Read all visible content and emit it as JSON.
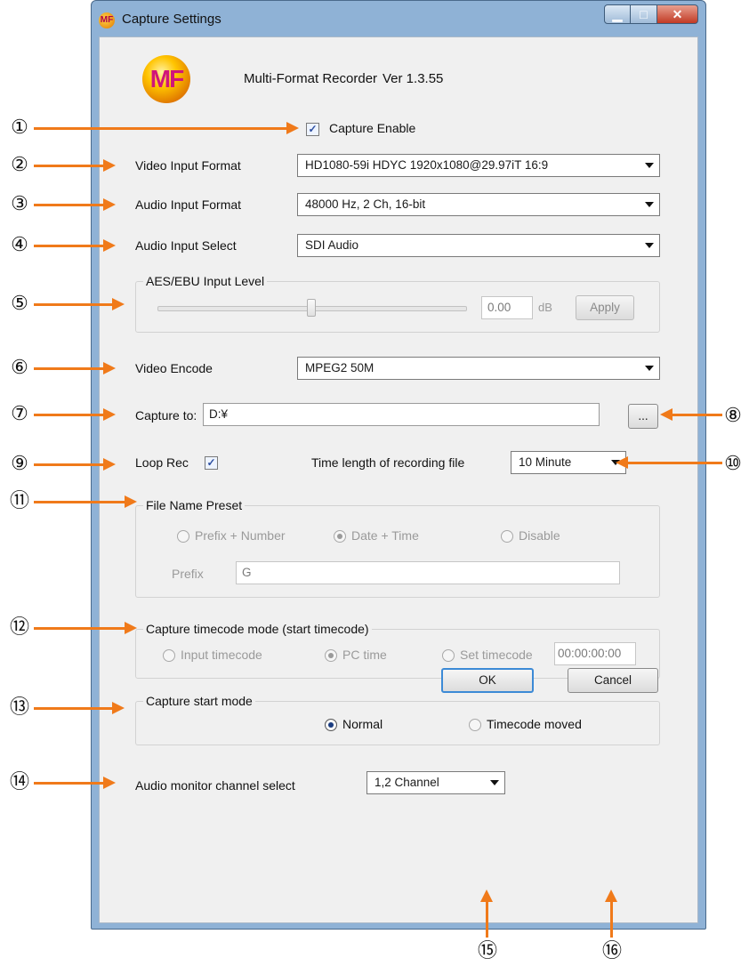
{
  "window": {
    "title": "Capture Settings",
    "app_name": "Multi-Format Recorder",
    "version": "Ver 1.3.55",
    "logo_text": "MF"
  },
  "capture_enable": {
    "label": "Capture Enable",
    "checked": true
  },
  "video_input_format": {
    "label": "Video Input Format",
    "value": "HD1080-59i HDYC 1920x1080@29.97iT 16:9"
  },
  "audio_input_format": {
    "label": "Audio Input Format",
    "value": "48000 Hz, 2 Ch, 16-bit"
  },
  "audio_input_select": {
    "label": "Audio Input Select",
    "value": "SDI Audio"
  },
  "aes_ebu": {
    "title": "AES/EBU Input Level",
    "value": "0.00",
    "unit": "dB",
    "apply_label": "Apply",
    "slider_level": 0.5
  },
  "video_encode": {
    "label": "Video Encode",
    "value": "MPEG2  50M"
  },
  "capture_to": {
    "label": "Capture to:",
    "value": "D:¥",
    "browse_label": "..."
  },
  "loop_rec": {
    "label": "Loop Rec",
    "checked": true
  },
  "time_length": {
    "label": "Time length of recording file",
    "value": "10 Minute"
  },
  "file_name_preset": {
    "title": "File Name Preset",
    "options": [
      "Prefix + Number",
      "Date + Time",
      "Disable"
    ],
    "selected": "Date + Time",
    "prefix_label": "Prefix",
    "prefix_value": "G"
  },
  "timecode_mode": {
    "title": "Capture timecode mode (start timecode)",
    "options": [
      "Input timecode",
      "PC time",
      "Set timecode"
    ],
    "selected": "PC time",
    "set_value": "00:00:00:00"
  },
  "start_mode": {
    "title": "Capture start mode",
    "options": [
      "Normal",
      "Timecode moved"
    ],
    "selected": "Normal"
  },
  "audio_monitor": {
    "label": "Audio monitor channel select",
    "value": "1,2 Channel"
  },
  "buttons": {
    "ok": "OK",
    "cancel": "Cancel"
  },
  "annotations": [
    "①",
    "②",
    "③",
    "④",
    "⑤",
    "⑥",
    "⑦",
    "⑧",
    "⑨",
    "⑩",
    "⑪",
    "⑫",
    "⑬",
    "⑭",
    "⑮",
    "⑯"
  ],
  "colors": {
    "annotation_arrow": "#f07a1a",
    "window_frame": "#8fb2d6",
    "client_bg": "#f0f0f0"
  }
}
